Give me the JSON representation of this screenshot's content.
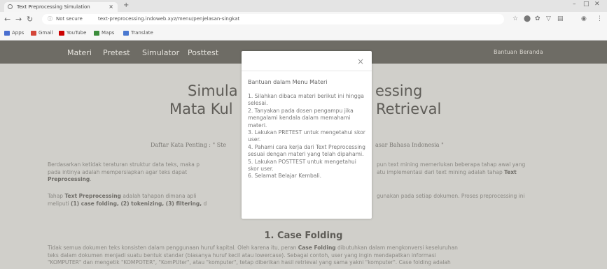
{
  "browser": {
    "tab_title": "Text Preprocessing Simulation",
    "tab_close": "×",
    "new_tab": "+",
    "security_label": "Not secure",
    "url": "text-preprocessing.indoweb.xyz/menu/penjelasan-singkat",
    "bookmarks": [
      {
        "label": "Apps",
        "color": "#4a6fd0"
      },
      {
        "label": "Gmail",
        "color": "#d44638"
      },
      {
        "label": "YouTube",
        "color": "#cc0000"
      },
      {
        "label": "Maps",
        "color": "#3b8c3b"
      },
      {
        "label": "Translate",
        "color": "#4a78d0"
      }
    ]
  },
  "site_nav": {
    "items": [
      "Materi",
      "Pretest",
      "Simulator",
      "Posttest"
    ],
    "right_items": [
      "Bantuan",
      "Beranda"
    ]
  },
  "page": {
    "title_line1_left": "Simula",
    "title_line1_right": "essing",
    "title_line2_left": "Mata Kul",
    "title_line2_right": "Retrieval",
    "daftar_left": "Daftar Kata Penting : \" Ste",
    "daftar_right": "asar Bahasa Indonesia \"",
    "para1_left": "Berdasarkan ketidak teraturan struktur data teks, maka p",
    "para1_right": "pun text mining memerlukan beberapa tahap awal yang",
    "para1b_left": "pada intinya adalah mempersiapkan agar teks dapat",
    "para1b_right": "atu implementasi dari text mining adalah tahap",
    "para1b_bold": "Text",
    "para1c_bold": "Preprocessing",
    "para1c_tail": ".",
    "para2_pre": "Tahap",
    "para2_bold": "Text Preprocessing",
    "para2_left": "adalah tahapan dimana apli",
    "para2_right": "gunakan pada setiap dokumen. Proses preprocessing ini",
    "para2b_pre": "meliputi",
    "para2b_bold": "(1) case folding, (2) tokenizing, (3) filtering,",
    "para2b_tail": "d",
    "section_title": "1. Case Folding",
    "para3_a": "Tidak semua dokumen teks konsisten dalam penggunaan huruf kapital. Oleh karena itu, peran",
    "para3_b_bold": "Case Folding",
    "para3_c": "dibutuhkan dalam mengkonversi keseluruhan",
    "para3_line2": "teks dalam dokumen menjadi suatu bentuk standar (biasanya huruf kecil atau lowercase). Sebagai contoh, user yang ingin mendapatkan informasi",
    "para3_line3_a": "\"KOMPUTER\" dan mengetik \"KOMPOTER\", \"KomPUter\", atau \"komputer\", tetap diberikan hasil retrieval yang sama yakni \"komputer\". Case folding adalah"
  },
  "modal": {
    "close": "×",
    "title": "Bantuan dalam Menu Materi",
    "items": [
      "1. Silahkan dibaca materi berikut ini hingga selesai.",
      "2. Tanyakan pada dosen pengampu jika mengalami kendala dalam memahami materi.",
      "3. Lakukan PRETEST untuk mengetahui skor user.",
      "4. Pahami cara kerja dari Text Preprocessing sesuai dengan materi yang telah dipahami.",
      "5. Lakukan POSTTEST untuk mengetahui skor user.",
      "6. Selamat Belajar Kembali."
    ]
  }
}
